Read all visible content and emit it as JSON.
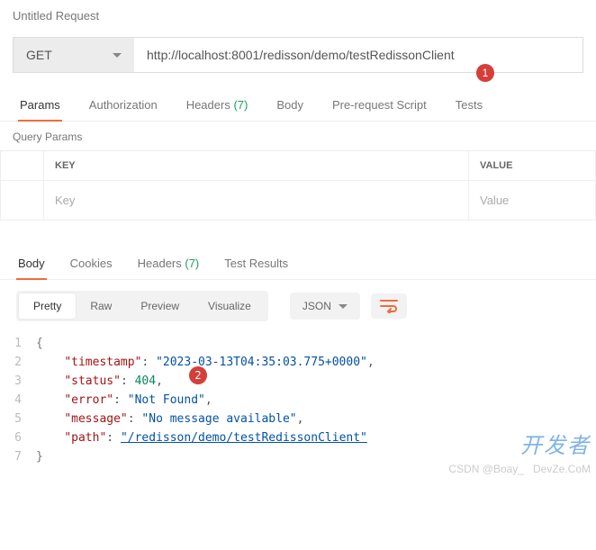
{
  "request": {
    "title": "Untitled Request",
    "method": "GET",
    "url": "http://localhost:8001/redisson/demo/testRedissonClient"
  },
  "annotations": {
    "badge1": "1",
    "badge2": "2"
  },
  "tabs_request": {
    "params": "Params",
    "authorization": "Authorization",
    "headers_label": "Headers",
    "headers_count": "(7)",
    "body": "Body",
    "prerequest": "Pre-request Script",
    "tests": "Tests"
  },
  "query_params": {
    "title": "Query Params",
    "key_header": "KEY",
    "value_header": "VALUE",
    "key_placeholder": "Key",
    "value_placeholder": "Value"
  },
  "tabs_response": {
    "body": "Body",
    "cookies": "Cookies",
    "headers_label": "Headers",
    "headers_count": "(7)",
    "test_results": "Test Results"
  },
  "view": {
    "pretty": "Pretty",
    "raw": "Raw",
    "preview": "Preview",
    "visualize": "Visualize",
    "format": "JSON"
  },
  "response_body": {
    "timestamp_key": "\"timestamp\"",
    "timestamp_val": "\"2023-03-13T04:35:03.775+0000\"",
    "status_key": "\"status\"",
    "status_val": "404",
    "error_key": "\"error\"",
    "error_val": "\"Not Found\"",
    "message_key": "\"message\"",
    "message_val": "\"No message available\"",
    "path_key": "\"path\"",
    "path_val": "\"/redisson/demo/testRedissonClient\""
  },
  "lines": {
    "l1": "1",
    "l2": "2",
    "l3": "3",
    "l4": "4",
    "l5": "5",
    "l6": "6",
    "l7": "7"
  },
  "watermark": {
    "brand": "开发者",
    "sub": "CSDN @Boay_",
    "domain": "DevZe.CoM"
  }
}
